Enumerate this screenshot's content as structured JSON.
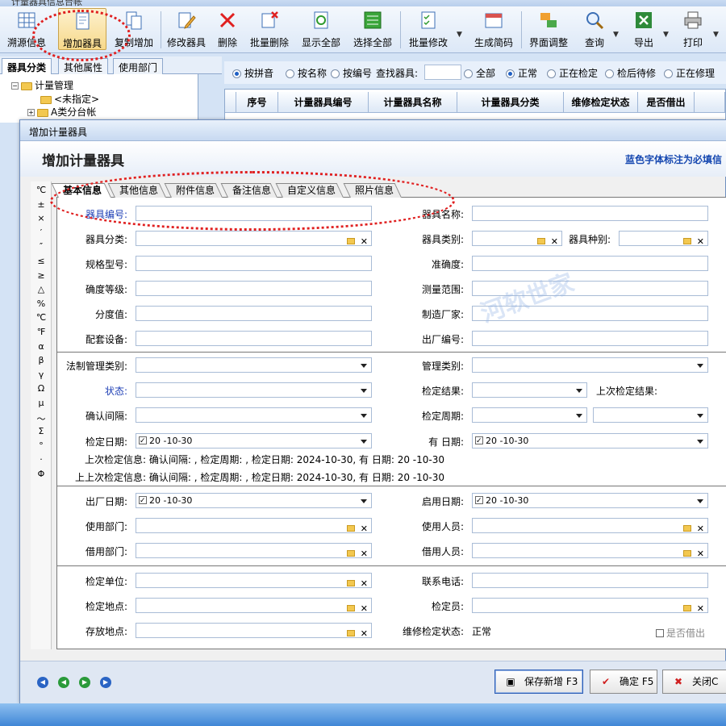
{
  "app": {
    "title": "计量器具信息台帐"
  },
  "toolbar": {
    "buttons": [
      {
        "label": "溯源信息"
      },
      {
        "label": "增加器具"
      },
      {
        "label": "复制增加"
      },
      {
        "label": "修改器具"
      },
      {
        "label": "删除"
      },
      {
        "label": "批量删除"
      },
      {
        "label": "显示全部"
      },
      {
        "label": "选择全部"
      },
      {
        "label": "批量修改"
      },
      {
        "label": "生成简码"
      },
      {
        "label": "界面调整"
      },
      {
        "label": "查询"
      },
      {
        "label": "导出"
      },
      {
        "label": "打印"
      }
    ]
  },
  "left_panel": {
    "tabs": [
      "器具分类",
      "其他属性",
      "使用部门"
    ],
    "tree": {
      "root": "计量管理",
      "items": [
        "<未指定>",
        "A类分台帐"
      ]
    }
  },
  "filter": {
    "search_modes": [
      "按拼音",
      "按名称",
      "按编号"
    ],
    "search_label": "查找器具:",
    "status_filters": [
      "全部",
      "正常",
      "正在检定",
      "检后待修",
      "正在修理"
    ]
  },
  "grid": {
    "columns": [
      "序号",
      "计量器具编号",
      "计量器具名称",
      "计量器具分类",
      "维修检定状态",
      "是否借出"
    ]
  },
  "dialog": {
    "title": "增加计量器具",
    "heading": "增加计量器具",
    "note": "蓝色字体标注为必填信",
    "tabs": [
      "基本信息",
      "其他信息",
      "附件信息",
      "备注信息",
      "自定义信息",
      "照片信息"
    ],
    "symbols": [
      "℃",
      "±",
      "×",
      "′",
      "″",
      "≤",
      "≥",
      "△",
      "%",
      "℃",
      "℉",
      "α",
      "β",
      "γ",
      "Ω",
      "μ",
      "～",
      "Σ",
      "°",
      "·",
      "Φ"
    ],
    "fields": {
      "code": "器具编号:",
      "name": "器具名称:",
      "category": "器具分类:",
      "type": "器具类别:",
      "kind": "器具种别:",
      "model": "规格型号:",
      "accuracy": "准确度:",
      "accuracy_grade": "确度等级:",
      "range": "测量范围:",
      "resolution": "分度值:",
      "manufacturer": "制造厂家:",
      "accessory": "配套设备:",
      "serial": "出厂编号:",
      "legal_type": "法制管理类别:",
      "mgmt_type": "管理类别:",
      "status": "状态:",
      "calib_result": "检定结果:",
      "last_result": "上次检定结果:",
      "confirm_interval": "确认间隔:",
      "calib_cycle": "检定周期:",
      "calib_date": "检定日期:",
      "calib_date_value": "20  -10-30",
      "valid_date": "有   日期:",
      "valid_date_value": "20  -10-30",
      "last_info": "上次检定信息: 确认间隔: , 检定周期: , 检定日期: 2024-10-30, 有   日期: 20  -10-30",
      "prev_info": "上上次检定信息: 确认间隔: , 检定周期: , 检定日期: 2024-10-30, 有   日期: 20  -10-30",
      "factory_date": "出厂日期:",
      "factory_date_value": "20  -10-30",
      "start_date": "启用日期:",
      "start_date_value": "20  -10-30",
      "use_dept": "使用部门:",
      "user": "使用人员:",
      "borrow_dept": "借用部门:",
      "borrower": "借用人员:",
      "calib_unit": "检定单位:",
      "phone": "联系电话:",
      "calib_place": "检定地点:",
      "calibrator": "检定员:",
      "storage": "存放地点:",
      "repair_status": "维修检定状态:",
      "repair_status_value": "正常",
      "lent_out": "是否借出"
    },
    "buttons": {
      "save_new": "保存新增 F3",
      "ok": "确定 F5",
      "close": "关闭C"
    }
  },
  "watermark": {
    "text": "河软世家"
  },
  "colors": {
    "required_label": "#1e3fb5",
    "note": "#1547b0",
    "annotation": "#e02020"
  }
}
